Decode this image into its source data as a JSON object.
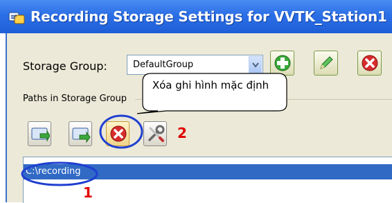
{
  "window": {
    "title": "Recording Storage Settings for VVTK_Station1"
  },
  "storage_group": {
    "label": "Storage Group:",
    "value": "DefaultGroup"
  },
  "group_toolbar": {
    "buttons": [
      "add-icon",
      "edit-icon",
      "delete-icon"
    ]
  },
  "paths": {
    "label": "Paths in Storage Group",
    "toolbar": [
      "add-path-icon",
      "import-path-icon",
      "delete-path-icon",
      "settings-tools-icon"
    ],
    "items": [
      "C:\\recording"
    ]
  },
  "annotation": {
    "callout": "Xóa ghi hình mặc định",
    "marker_1": "1",
    "marker_2": "2",
    "color": "#e00000",
    "highlight_color": "#1f3fd0"
  }
}
